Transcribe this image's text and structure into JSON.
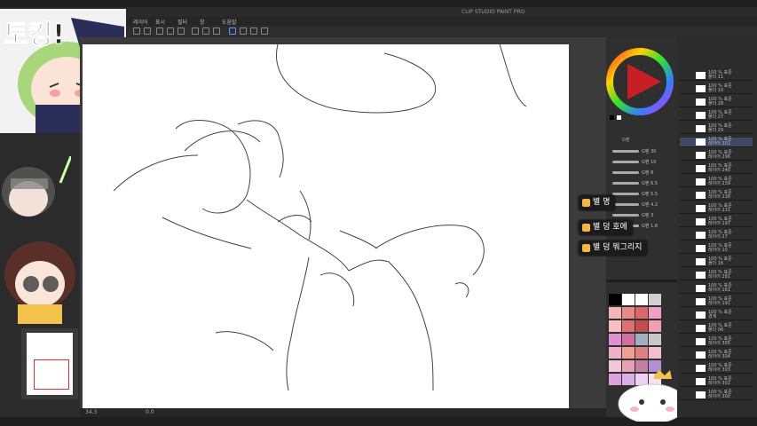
{
  "window": {
    "title": "CLIP STUDIO PAINT PRO"
  },
  "overlay": {
    "sticker_text": "토킹!"
  },
  "menu": [
    "레이어",
    "표시",
    "필터",
    "창",
    "도움말"
  ],
  "statusbar": {
    "zoom": "34.3",
    "angle": "0.0"
  },
  "brush": {
    "header": "G펜",
    "sizes": [
      "G펜 30",
      "G펜 10",
      "G펜 8",
      "G펜 6.5",
      "G펜 5.5",
      "G펜 4.2",
      "G펜 3",
      "G펜 1.8"
    ]
  },
  "alerts": [
    {
      "text": "별 명"
    },
    {
      "text": "별 덩 호에"
    },
    {
      "text": "별 덩 뭐그리지"
    }
  ],
  "layers": [
    "폴더 11",
    "폴더 10",
    "폴더 28",
    "폴더 27",
    "폴더 29",
    "레이어 301",
    "레이어 296",
    "레이어 240",
    "레이어 239",
    "레이어 238",
    "레이어 231",
    "레이어 197",
    "레이어 27",
    "레이어 10",
    "폴더 16",
    "레이어 281",
    "레이어 161",
    "레이어 191",
    "경계",
    "폴더 06",
    "레이어 305",
    "레이어 304",
    "레이어 303",
    "레이어 302",
    "레이어 300"
  ],
  "layer_opacity": "100 % 표준",
  "colors": {
    "accent": "#5aa0ff",
    "alert_icon": "#f5b642",
    "palette": [
      "#000000",
      "#ffffff",
      "#ffffff",
      "#d0d0d0",
      "#f5b5b5",
      "#e88a8a",
      "#d96a6a",
      "#f0a0c0",
      "#f5c0c0",
      "#e07070",
      "#c05050",
      "#f0a0b0",
      "#e090d0",
      "#d070a0",
      "#a0b0c0",
      "#c8c8c8",
      "#f0b0c8",
      "#f0a090",
      "#e08080",
      "#f0c0d0",
      "#f0c8d8",
      "#e8a0b8",
      "#c080a0",
      "#b090d0",
      "#e0a0e0",
      "#d8b0e8",
      "#f0d0f0",
      "#f8e0f0"
    ]
  }
}
